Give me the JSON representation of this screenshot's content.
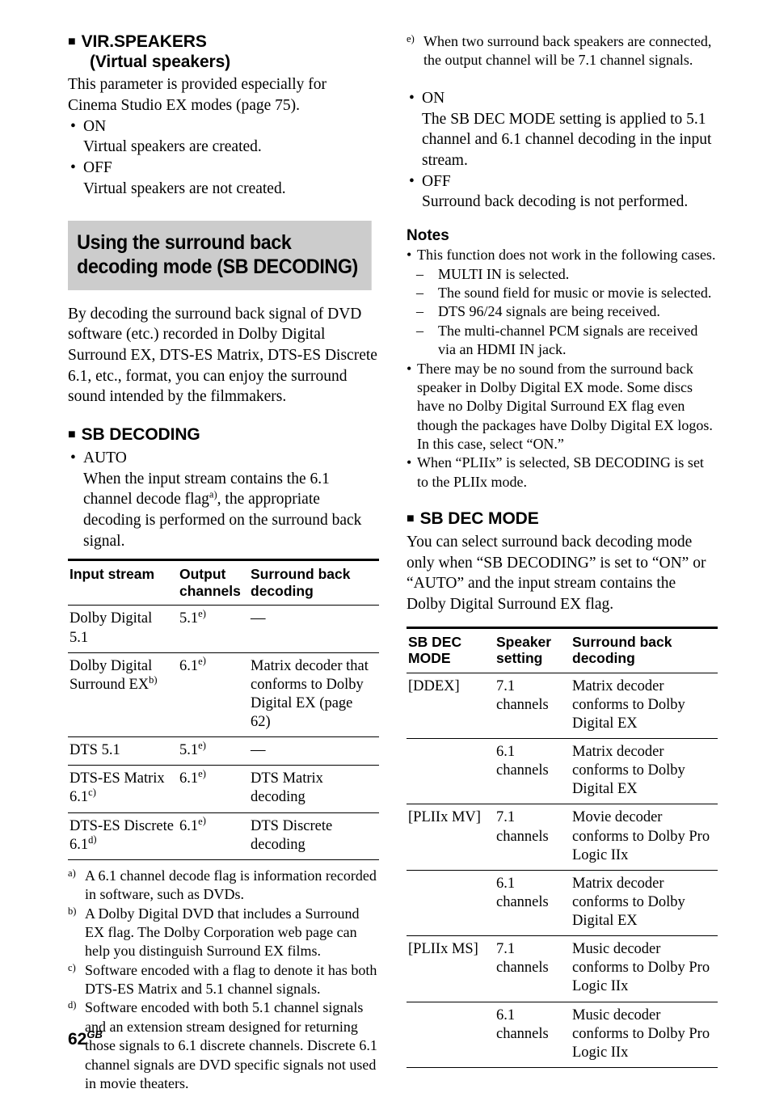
{
  "left": {
    "vir_speakers": {
      "square": "■",
      "title_line1": "VIR.SPEAKERS",
      "title_line2": "(Virtual speakers)",
      "intro": "This parameter is provided especially for Cinema Studio EX modes (page 75).",
      "options": [
        {
          "label": "ON",
          "desc": "Virtual speakers are created."
        },
        {
          "label": "OFF",
          "desc": "Virtual speakers are not created."
        }
      ]
    },
    "banner": "Using the surround back decoding mode (SB DECODING)",
    "sb_decoding": {
      "intro": "By decoding the surround back signal of DVD software (etc.) recorded in Dolby Digital Surround EX, DTS-ES Matrix, DTS-ES Discrete 6.1, etc., format, you can enjoy the surround sound intended by the filmmakers.",
      "square": "■",
      "title": "SB DECODING",
      "auto_label": "AUTO",
      "auto_desc_1": "When the input stream contains the 6.1 channel decode flag",
      "auto_desc_mark": "a",
      "auto_desc_2": ", the appropriate decoding is performed on the surround back signal."
    },
    "table": {
      "headers": [
        "Input stream",
        "Output channels",
        "Surround back decoding"
      ],
      "rows": [
        {
          "stream": "Dolby Digital 5.1",
          "stream_mark": "",
          "channels": "5.1",
          "channels_mark": "e",
          "decoding": "—"
        },
        {
          "stream": "Dolby Digital Surround EX",
          "stream_mark": "b",
          "channels": "6.1",
          "channels_mark": "e",
          "decoding": "Matrix decoder that conforms to Dolby Digital EX (page 62)"
        },
        {
          "stream": "DTS 5.1",
          "stream_mark": "",
          "channels": "5.1",
          "channels_mark": "e",
          "decoding": "—"
        },
        {
          "stream": "DTS-ES Matrix 6.1",
          "stream_mark": "c",
          "channels": "6.1",
          "channels_mark": "e",
          "decoding": "DTS Matrix decoding"
        },
        {
          "stream": "DTS-ES Discrete 6.1",
          "stream_mark": "d",
          "channels": "6.1",
          "channels_mark": "e",
          "decoding": "DTS Discrete decoding"
        }
      ]
    },
    "footnotes": [
      {
        "mark": "a",
        "text": "A 6.1 channel decode flag is information recorded in software, such as DVDs."
      },
      {
        "mark": "b",
        "text": "A Dolby Digital DVD that includes a Surround EX flag. The Dolby Corporation web page can help you distinguish Surround EX films."
      },
      {
        "mark": "c",
        "text": "Software encoded with a flag to denote it has both DTS-ES Matrix and 5.1 channel signals."
      },
      {
        "mark": "d",
        "text": "Software encoded with both 5.1 channel signals and an extension stream designed for returning those signals to 6.1 discrete channels. Discrete 6.1 channel signals are DVD specific signals not used in movie theaters."
      }
    ],
    "page_number": "62",
    "page_suffix": "GB"
  },
  "right": {
    "footnote_e": {
      "mark": "e",
      "text": "When two surround back speakers are connected, the output channel will be 7.1 channel signals."
    },
    "options": [
      {
        "label": "ON",
        "desc": "The SB DEC MODE setting is applied to 5.1 channel and 6.1 channel decoding in the input stream."
      },
      {
        "label": "OFF",
        "desc": "Surround back decoding is not performed."
      }
    ],
    "notes": {
      "title": "Notes",
      "items": [
        "This function does not work in the following cases.",
        "There may be no sound from the surround back speaker in Dolby Digital EX mode. Some discs have no Dolby Digital Surround EX flag even though the packages have Dolby Digital EX logos. In this case, select “ON.”",
        "When “PLIIx” is selected, SB DECODING is set to the PLIIx mode."
      ],
      "sub_items": [
        "MULTI IN is selected.",
        "The sound field for music or movie is selected.",
        "DTS 96/24 signals are being received.",
        "The multi-channel PCM signals are received via an HDMI IN jack."
      ]
    },
    "sb_dec_mode": {
      "square": "■",
      "title": "SB DEC MODE",
      "intro": "You can select surround back decoding mode only when “SB DECODING” is set to “ON” or “AUTO” and the input stream contains the Dolby Digital Surround EX flag."
    },
    "table": {
      "headers": [
        "SB DEC MODE",
        "Speaker setting",
        "Surround back decoding"
      ],
      "rows": [
        {
          "mode": "[DDEX]",
          "speaker": "7.1 channels",
          "decoding": "Matrix decoder conforms to Dolby Digital EX",
          "first": true
        },
        {
          "mode": "",
          "speaker": "6.1 channels",
          "decoding": "Matrix decoder conforms to Dolby Digital EX",
          "first": false
        },
        {
          "mode": "[PLIIx MV]",
          "speaker": "7.1 channels",
          "decoding": "Movie decoder conforms to Dolby Pro Logic IIx",
          "first": true
        },
        {
          "mode": "",
          "speaker": "6.1 channels",
          "decoding": "Matrix decoder conforms to Dolby Digital EX",
          "first": false
        },
        {
          "mode": "[PLIIx MS]",
          "speaker": "7.1 channels",
          "decoding": "Music decoder conforms to Dolby Pro Logic IIx",
          "first": true
        },
        {
          "mode": "",
          "speaker": "6.1 channels",
          "decoding": "Music decoder conforms to Dolby Pro Logic IIx",
          "first": false
        }
      ]
    }
  }
}
